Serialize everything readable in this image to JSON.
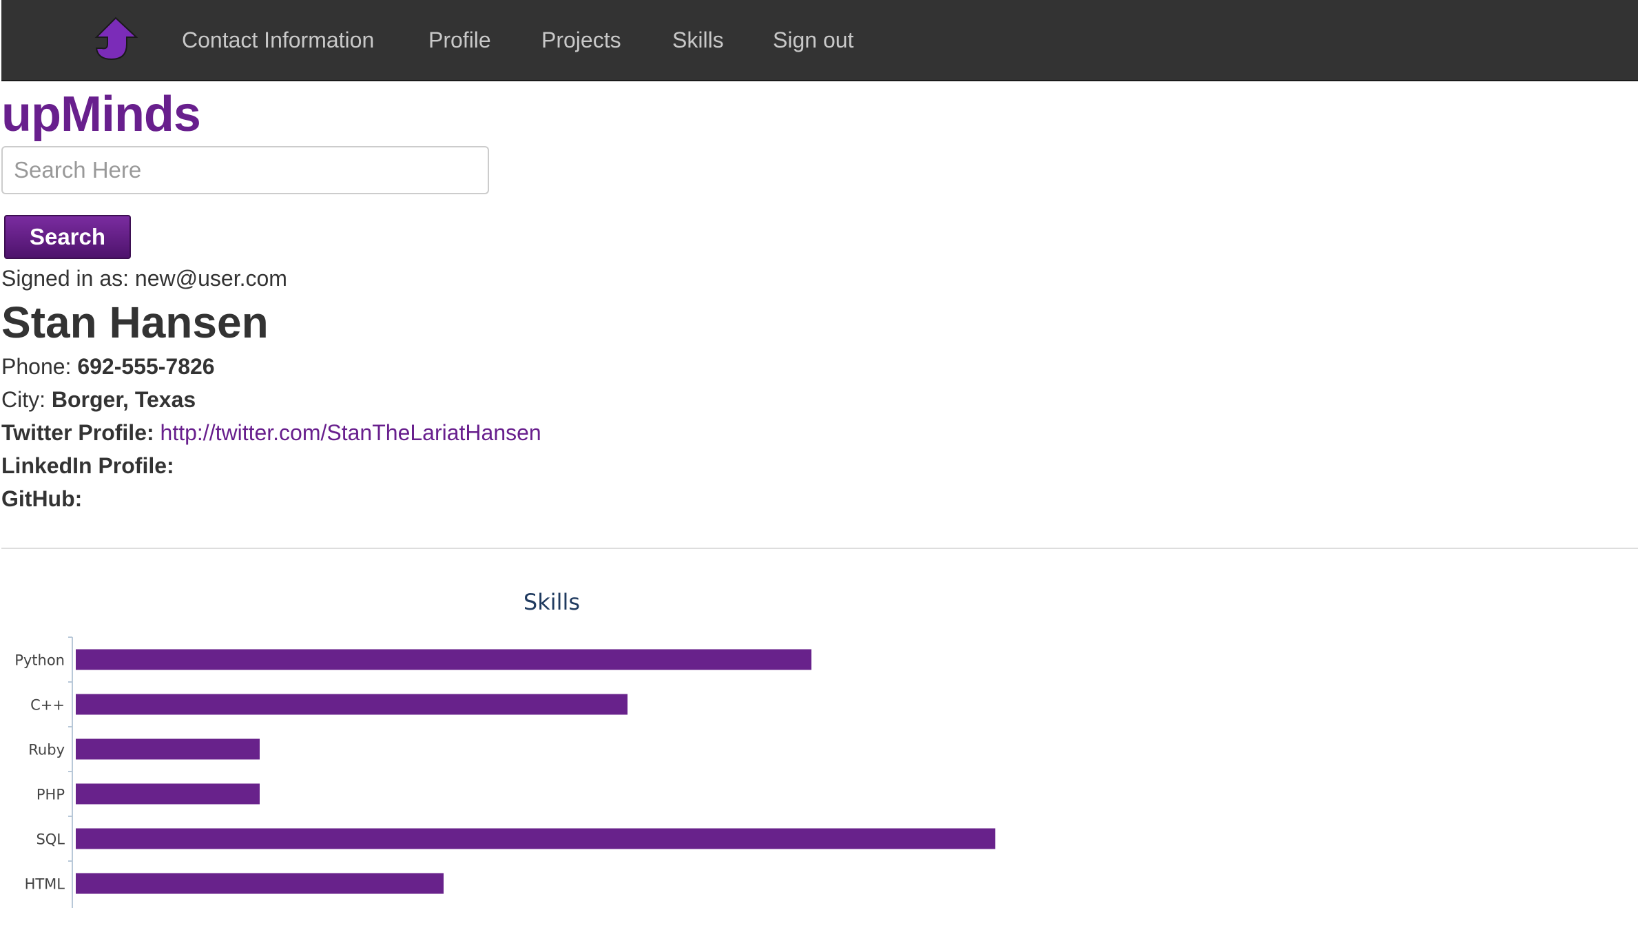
{
  "nav": {
    "logo_icon": "up-arrow-logo-icon",
    "items": [
      {
        "label": "Contact Information"
      },
      {
        "label": "Profile"
      },
      {
        "label": "Projects"
      },
      {
        "label": "Skills"
      },
      {
        "label": "Sign out"
      }
    ]
  },
  "brand": "upMinds",
  "search": {
    "placeholder": "Search Here",
    "value": "",
    "button_label": "Search"
  },
  "signed_in": {
    "label": "Signed in as:",
    "email": "new@user.com"
  },
  "profile": {
    "name": "Stan Hansen",
    "phone_label": "Phone:",
    "phone": "692-555-7826",
    "city_label": "City:",
    "city": "Borger, Texas",
    "twitter_label": "Twitter Profile:",
    "twitter": "http://twitter.com/StanTheLariatHansen",
    "linkedin_label": "LinkedIn Profile:",
    "linkedin": "",
    "github_label": "GitHub:",
    "github": ""
  },
  "colors": {
    "brand": "#681f8d",
    "navbar": "#333333",
    "bar": "#68228b",
    "chart_title": "#1f3a5f"
  },
  "chart_data": {
    "type": "bar",
    "orientation": "horizontal",
    "title": "Skills",
    "categories": [
      "Python",
      "C++",
      "Ruby",
      "PHP",
      "SQL",
      "HTML"
    ],
    "values": [
      8,
      6,
      2,
      2,
      10,
      4
    ],
    "xlim": [
      0,
      10
    ],
    "xlabel": "",
    "ylabel": "",
    "grid": false,
    "legend": "none"
  }
}
